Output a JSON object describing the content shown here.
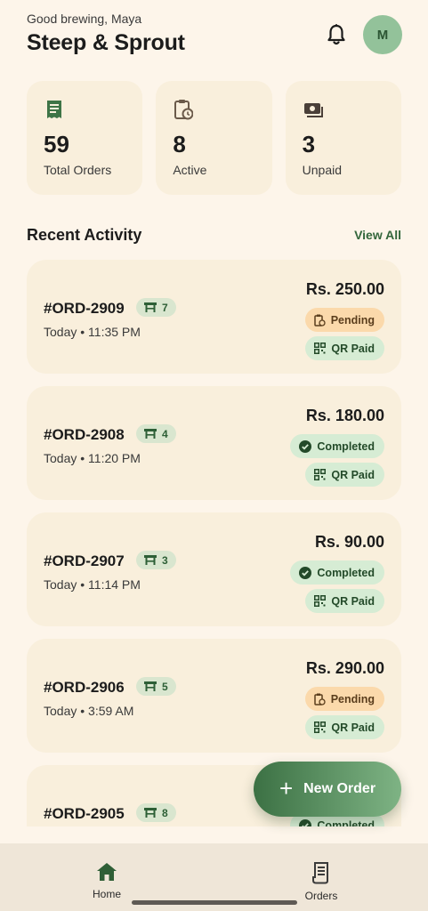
{
  "header": {
    "greeting": "Good brewing, Maya",
    "title": "Steep & Sprout",
    "avatar_initial": "M"
  },
  "stats": [
    {
      "icon": "receipt-icon",
      "value": "59",
      "label": "Total Orders"
    },
    {
      "icon": "clipboard-clock-icon",
      "value": "8",
      "label": "Active"
    },
    {
      "icon": "payments-icon",
      "value": "3",
      "label": "Unpaid"
    }
  ],
  "recent": {
    "title": "Recent Activity",
    "view_all": "View All",
    "orders": [
      {
        "id": "#ORD-2909",
        "table": "7",
        "time": "Today • 11:35 PM",
        "amount": "Rs. 250.00",
        "status": "Pending",
        "payment": "QR Paid"
      },
      {
        "id": "#ORD-2908",
        "table": "4",
        "time": "Today • 11:20 PM",
        "amount": "Rs. 180.00",
        "status": "Completed",
        "payment": "QR Paid"
      },
      {
        "id": "#ORD-2907",
        "table": "3",
        "time": "Today • 11:14 PM",
        "amount": "Rs. 90.00",
        "status": "Completed",
        "payment": "QR Paid"
      },
      {
        "id": "#ORD-2906",
        "table": "5",
        "time": "Today • 3:59 AM",
        "amount": "Rs. 290.00",
        "status": "Pending",
        "payment": "QR Paid"
      },
      {
        "id": "#ORD-2905",
        "table": "8",
        "status": "Completed"
      }
    ]
  },
  "fab": {
    "label": "New Order"
  },
  "nav": {
    "home": "Home",
    "orders": "Orders"
  },
  "colors": {
    "accent": "#33663b",
    "background": "#fdf5ea",
    "card": "#f9efdc",
    "pending": "#fbd9ab",
    "completed": "#d6ecd4"
  }
}
